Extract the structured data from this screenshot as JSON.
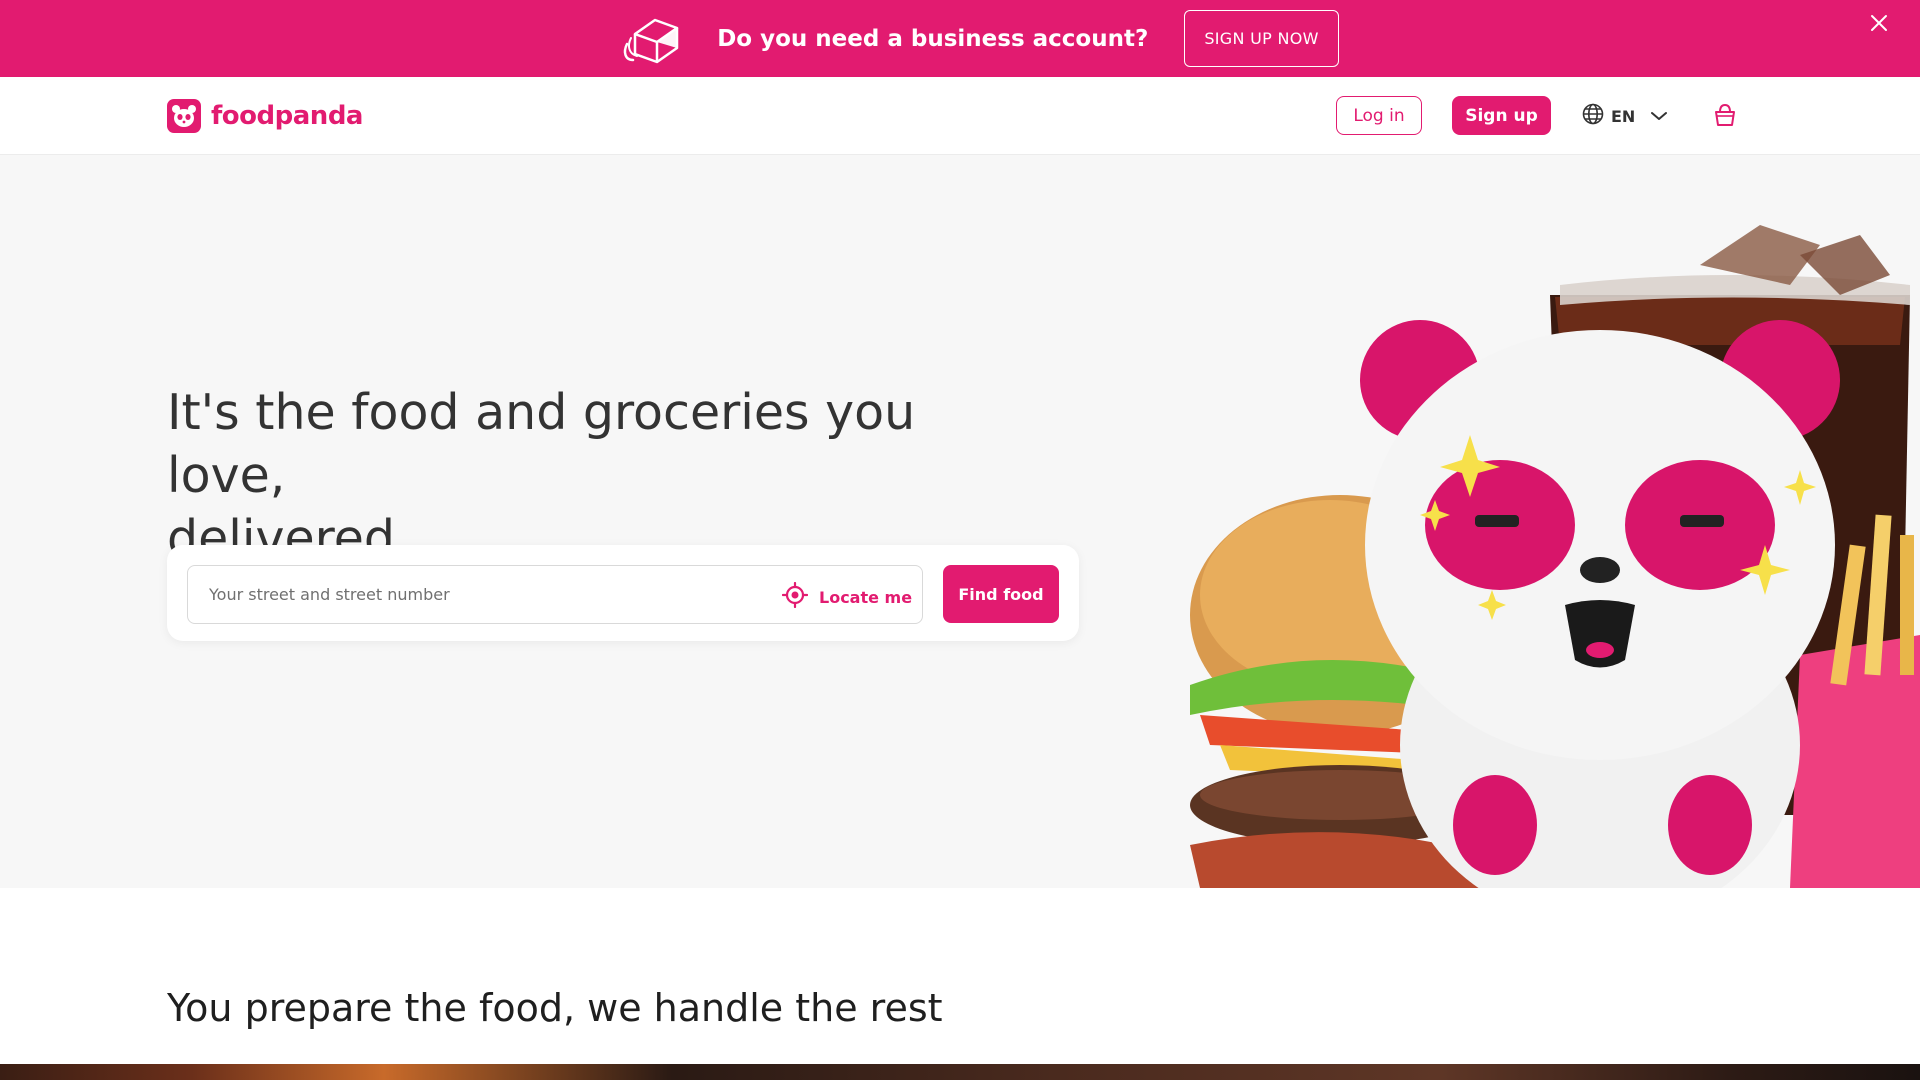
{
  "colors": {
    "brand": "#e21b70",
    "hero_bg": "#f7f7f7",
    "text": "#333333"
  },
  "banner": {
    "icon": "business-box-icon",
    "title": "Do you need a business account?",
    "cta_label": "SIGN UP NOW",
    "close_icon": "close-icon"
  },
  "header": {
    "logo_text": "foodpanda",
    "login_label": "Log in",
    "signup_label": "Sign up",
    "language": "EN",
    "language_icon": "globe-icon",
    "cart_icon": "shopping-bag-icon"
  },
  "hero": {
    "title_line1": "It's the food and groceries you love,",
    "title_line2": "delivered",
    "search_placeholder": "Your street and street number",
    "locate_label": "Locate me",
    "find_label": "Find food",
    "image": "panda-mascot-with-burger-and-soda"
  },
  "section": {
    "title": "You prepare the food, we handle the rest"
  }
}
